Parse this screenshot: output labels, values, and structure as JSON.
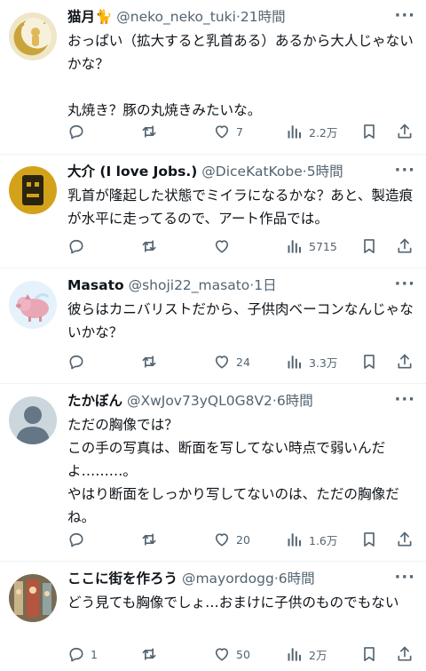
{
  "tweets": [
    {
      "name": "猫月🐈",
      "handle": "@neko_neko_tuki",
      "time": "21時間",
      "text": "おっぱい（拡大すると乳首ある）あるから大人じゃないかな？\n\n丸焼き？豚の丸焼きみたいな。",
      "replies": "",
      "retweets": "",
      "likes": "7",
      "views": "2.2万"
    },
    {
      "name": "大介 (I love Jobs.)",
      "handle": "@DiceKatKobe",
      "time": "5時間",
      "text": "乳首が隆起した状態でミイラになるかな？あと、製造痕が水平に走ってるので、アート作品では。",
      "replies": "",
      "retweets": "",
      "likes": "",
      "views": "5715"
    },
    {
      "name": "Masato",
      "handle": "@shoji22_masato",
      "time": "1日",
      "text": "彼らはカニバリストだから、子供肉ベーコンなんじゃないかな？",
      "replies": "",
      "retweets": "",
      "likes": "24",
      "views": "3.3万"
    },
    {
      "name": "たかぼん",
      "handle": "@XwJov73yQL0G8V2",
      "time": "6時間",
      "text": "ただの胸像では？\nこの手の写真は、断面を写してない時点で弱いんだよ………。\nやはり断面をしっかり写してないのは、ただの胸像だね。",
      "replies": "",
      "retweets": "",
      "likes": "20",
      "views": "1.6万"
    },
    {
      "name": "ここに街を作ろう",
      "handle": "@mayordogg",
      "time": "6時間",
      "text": "どう見ても胸像でしょ…おまけに子供のものでもない",
      "replies": "1",
      "retweets": "",
      "likes": "50",
      "views": "2万"
    }
  ],
  "separator": "·",
  "colors": {
    "text": "#0f1419",
    "secondary": "#536471",
    "divider": "#eff3f4"
  }
}
